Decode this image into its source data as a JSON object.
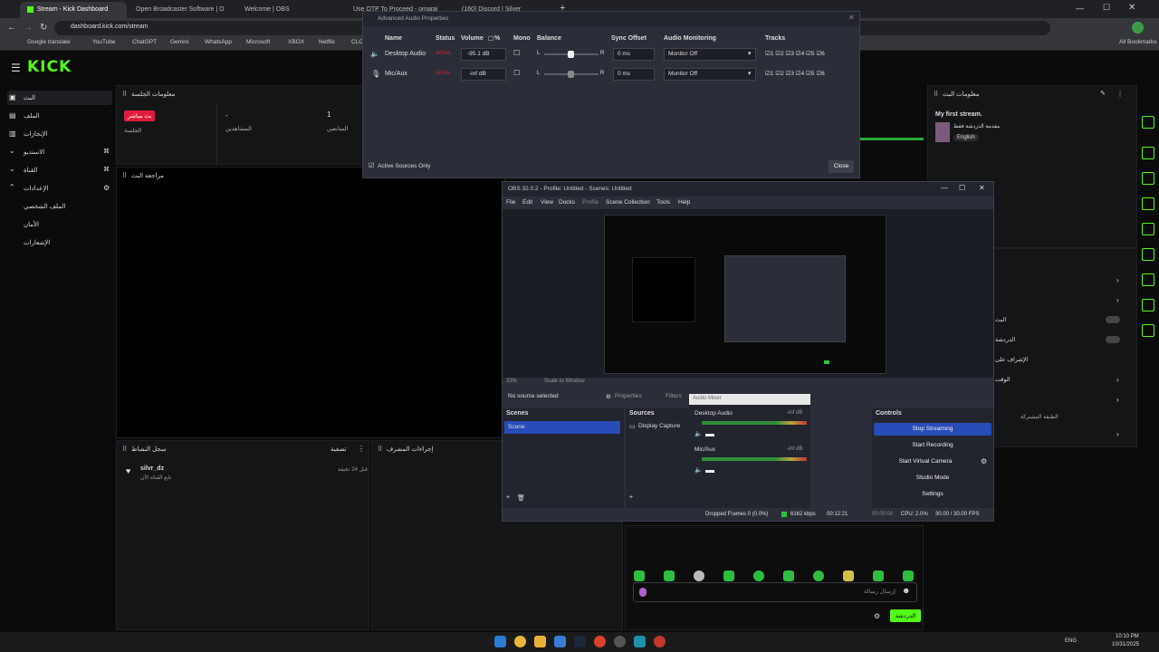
{
  "browser": {
    "tabs": [
      "Stream - Kick Dashboard",
      "Open Broadcaster Software | O",
      "Welcome | OBS",
      "Use OTP To Proceed - omarai",
      "(160) Discord | Silver"
    ],
    "url": "dashboard.kick.com/stream",
    "bookmarks": [
      "Google translate",
      "YouTube",
      "ChatGPT",
      "Gemini",
      "WhatsApp",
      "Microsoft",
      "XBOX",
      "Netflix",
      "CLC"
    ],
    "all_bookmarks": "All Bookmarks"
  },
  "kick": {
    "logo": "KICK",
    "sidebar": [
      {
        "label": "البث"
      },
      {
        "label": "الملف"
      },
      {
        "label": "الإنجازات"
      },
      {
        "label": "الاستديو"
      },
      {
        "label": "القناة"
      },
      {
        "label": "الإعدادات"
      },
      {
        "label": "الملف الشخصي"
      },
      {
        "label": "الأمان"
      },
      {
        "label": "الإشعارات"
      }
    ],
    "session_panel": {
      "title": "معلومات الجلسة",
      "live_badge": "بث مباشر",
      "live_sub": "الجلسة",
      "viewers_value": "-",
      "viewers_label": "المشاهدين",
      "followers_value": "1",
      "followers_label": "المتابعين"
    },
    "preview_title": "مراجعة البث",
    "activity": {
      "title": "سجل النشاط",
      "filter": "تصفية",
      "user": "silvr_dz",
      "user_sub": "تابع القناة الآن",
      "time": "قبل 24 دقيقة"
    },
    "mod_actions_title": "إجراءات المشرف",
    "stream_info": {
      "title": "معلومات البث",
      "stream_name": "My first stream.",
      "category": "مقدمة الدردشة فقط",
      "language": "English"
    },
    "chat": {
      "placeholder": "إرسال رسالة",
      "send": "الدردشة"
    },
    "right_labels": [
      "البث",
      "الدردشة",
      "الإشراف على",
      "الوقت"
    ],
    "right_label_small": "الطبقة المشتركة"
  },
  "audio_props": {
    "title": "Advanced Audio Properties",
    "headers": [
      "Name",
      "Status",
      "Volume",
      "%",
      "Mono",
      "Balance",
      "Sync Offset",
      "Audio Monitoring",
      "Tracks"
    ],
    "rows": [
      {
        "name": "Desktop Audio",
        "status": "Active",
        "volume": "-95.1 dB",
        "sync": "0 ms",
        "monitoring": "Monitor Off"
      },
      {
        "name": "Mic/Aux",
        "status": "Active",
        "volume": "-inf dB",
        "sync": "0 ms",
        "monitoring": "Monitor Off"
      }
    ],
    "balance_l": "L",
    "balance_r": "R",
    "tracks": [
      "1",
      "2",
      "3",
      "4",
      "5",
      "6"
    ],
    "active_sources": "Active Sources Only",
    "close": "Close"
  },
  "obs": {
    "title": "OBS 32.0.2 - Profile: Untitled - Scenes: Untitled",
    "menu": [
      "File",
      "Edit",
      "View",
      "Docks",
      "Profile",
      "Scene Collection",
      "Tools",
      "Help"
    ],
    "zoom": "33%",
    "scale": "Scale to Window",
    "no_source": "No source selected",
    "properties": "Properties",
    "filters": "Filters",
    "scenes_title": "Scenes",
    "scene_item": "Scene",
    "sources_title": "Sources",
    "source_item": "Display Capture",
    "mixer_title": "Audio Mixer",
    "mixer_channels": [
      {
        "name": "Desktop Audio",
        "level": "-inf dB"
      },
      {
        "name": "Mic/Aux",
        "level": "-inf dB"
      }
    ],
    "controls_title": "Controls",
    "controls": [
      "Stop Streaming",
      "Start Recording",
      "Start Virtual Camera",
      "Studio Mode",
      "Settings"
    ],
    "status": {
      "dropped": "Dropped Frames 0 (0.0%)",
      "bitrate": "6162 kbps",
      "live_time": "00:12:21",
      "rec_time": "00:00:00",
      "cpu": "CPU: 2.0%",
      "fps": "30.00 / 30.00 FPS"
    }
  },
  "taskbar": {
    "lang": "ENG",
    "time": "10:10 PM",
    "date": "10/31/2025"
  },
  "colors": {
    "kick_green": "#53fc18",
    "obs_blue": "#284cb8",
    "live_red": "#e01b3c"
  }
}
